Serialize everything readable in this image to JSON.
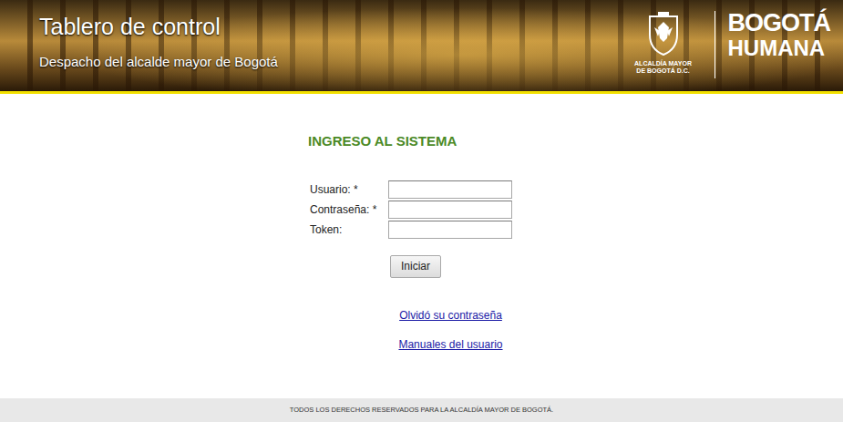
{
  "header": {
    "title": "Tablero de control",
    "subtitle": "Despacho del alcalde mayor de Bogotá",
    "logo": {
      "entity": [
        "ALCALDÍA MAYOR",
        "DE BOGOTÁ D.C."
      ],
      "brand_top": "BOGOTÁ",
      "brand_bottom": "HUMANA"
    }
  },
  "login": {
    "heading": "INGRESO AL SISTEMA",
    "fields": [
      {
        "label": "Usuario: *"
      },
      {
        "label": "Contraseña: *"
      },
      {
        "label": "Token:"
      }
    ],
    "submit": "Iniciar"
  },
  "links": [
    "Olvidó su contraseña",
    "Manuales del usuario"
  ],
  "footer": "TODOS LOS DERECHOS RESERVADOS PARA LA ALCALDÍA MAYOR DE BOGOTÁ."
}
